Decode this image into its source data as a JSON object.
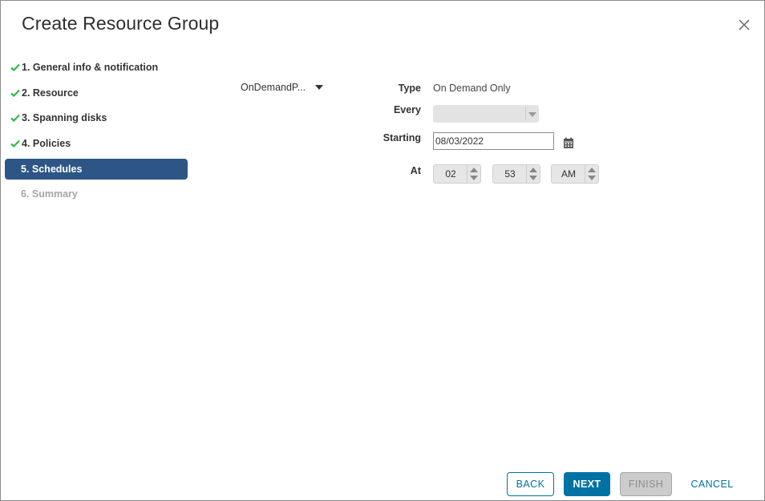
{
  "dialog": {
    "title": "Create Resource Group",
    "close_icon": "close-icon"
  },
  "steps": [
    {
      "label": "1. General info & notification",
      "state": "completed",
      "icon": "check-icon"
    },
    {
      "label": "2. Resource",
      "state": "completed",
      "icon": "check-icon"
    },
    {
      "label": "3. Spanning disks",
      "state": "completed",
      "icon": "check-icon"
    },
    {
      "label": "4. Policies",
      "state": "completed",
      "icon": "check-icon"
    },
    {
      "label": "5. Schedules",
      "state": "active"
    },
    {
      "label": "6. Summary",
      "state": "disabled"
    }
  ],
  "schedule": {
    "policy_selected": "OnDemandP...",
    "type_label": "Type",
    "type_value": "On Demand Only",
    "every_label": "Every",
    "every_value": "",
    "starting_label": "Starting",
    "starting_value": "08/03/2022",
    "calendar_icon": "calendar-icon",
    "at_label": "At",
    "hour": "02",
    "minute": "53",
    "ampm": "AM"
  },
  "footer": {
    "back": "BACK",
    "next": "NEXT",
    "finish": "FINISH",
    "cancel": "CANCEL"
  },
  "colors": {
    "active_step": "#2d5686",
    "check": "#2fb84a",
    "primary": "#0072a3"
  }
}
